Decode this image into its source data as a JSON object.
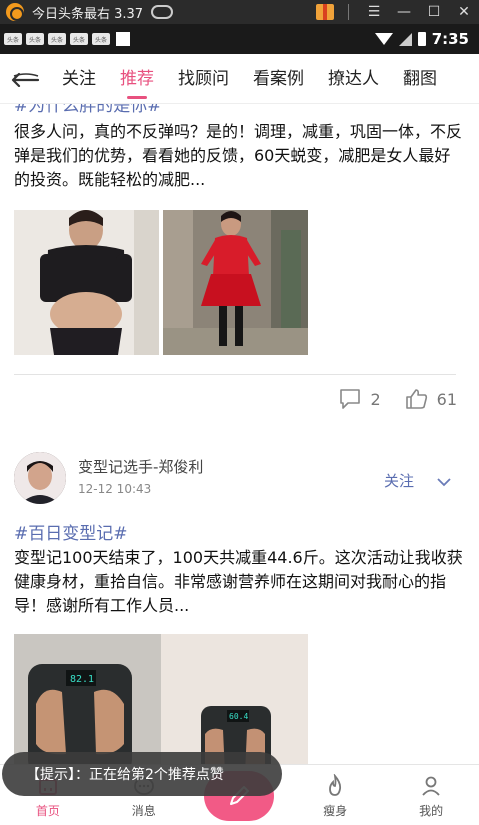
{
  "emulator": {
    "title": "今日头条最右 3.37",
    "controls": {
      "menu": "☰",
      "minimize": "—",
      "maximize": "☐",
      "close": "✕"
    }
  },
  "status_bar": {
    "notif_label": "头条",
    "time": "7:35"
  },
  "tabs": [
    {
      "label": "关注",
      "active": false
    },
    {
      "label": "推荐",
      "active": true
    },
    {
      "label": "找顾问",
      "active": false
    },
    {
      "label": "看案例",
      "active": false
    },
    {
      "label": "撩达人",
      "active": false
    },
    {
      "label": "翻图",
      "active": false
    }
  ],
  "feed": {
    "post1": {
      "hashtag": "#为什么胖的是你#",
      "text": "很多人问，真的不反弹吗？是的！调理，减重，巩固一体，不反弹是我们的优势，看看她的反馈，60天蜕变，减肥是女人最好的投资。既能轻松的减肥...",
      "comments": "2",
      "likes": "61"
    },
    "post2": {
      "username": "变型记选手-郑俊利",
      "time": "12-12 10:43",
      "follow_label": "关注",
      "hashtag": "#百日变型记#",
      "text": "变型记100天结束了，100天共减重44.6斤。这次活动让我收获健康身材，重拾自信。非常感谢营养师在这期间对我耐心的指导！感谢所有工作人员...",
      "scale_readings": [
        "82.1",
        "60.4"
      ]
    }
  },
  "bottom_nav": [
    {
      "label": "首页",
      "active": true
    },
    {
      "label": "消息",
      "active": false
    },
    {
      "label": "",
      "active": false
    },
    {
      "label": "瘦身",
      "active": false
    },
    {
      "label": "我的",
      "active": false
    }
  ],
  "toast": "【提示】：正在给第2个推荐点赞",
  "colors": {
    "accent": "#e8517f",
    "hashtag": "#5a6db0",
    "center_button": "#f25a86"
  }
}
